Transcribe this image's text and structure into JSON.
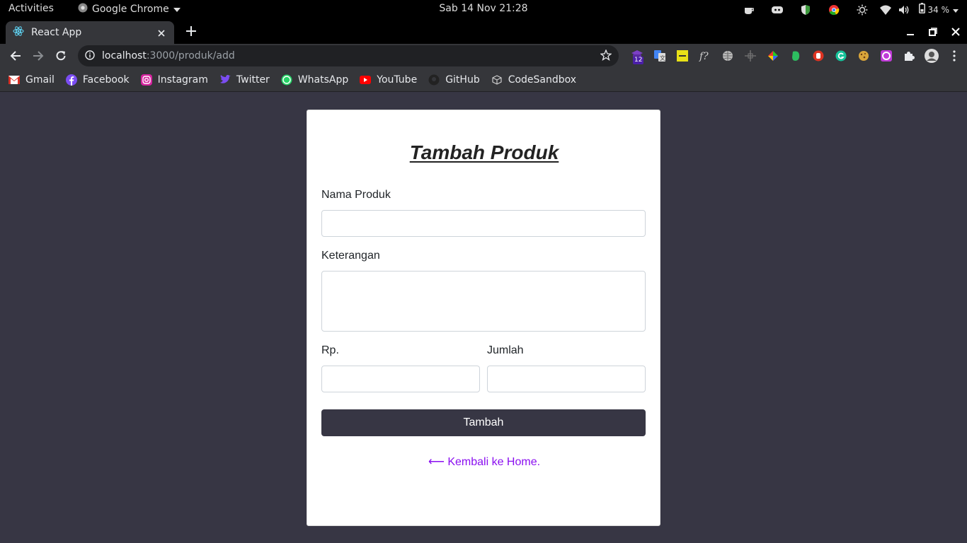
{
  "system_bar": {
    "activities": "Activities",
    "app_name": "Google Chrome",
    "datetime": "Sab 14 Nov  21:28",
    "battery": "34 %"
  },
  "browser": {
    "tab_title": "React App",
    "url_host": "localhost",
    "url_path": ":3000/produk/add",
    "extension_badge": "12",
    "bookmarks": [
      "Gmail",
      "Facebook",
      "Instagram",
      "Twitter",
      "WhatsApp",
      "YouTube",
      "GitHub",
      "CodeSandbox"
    ]
  },
  "form": {
    "title": "Tambah Produk",
    "name_label": "Nama Produk",
    "name_value": "",
    "desc_label": "Keterangan",
    "desc_value": "",
    "price_label": "Rp.",
    "price_value": "",
    "qty_label": "Jumlah",
    "qty_value": "",
    "submit_label": "Tambah",
    "back_link": "⟵ Kembali ke Home."
  },
  "colors": {
    "page_bg": "#373644",
    "button_bg": "#373644",
    "link": "#8a0ef0"
  }
}
